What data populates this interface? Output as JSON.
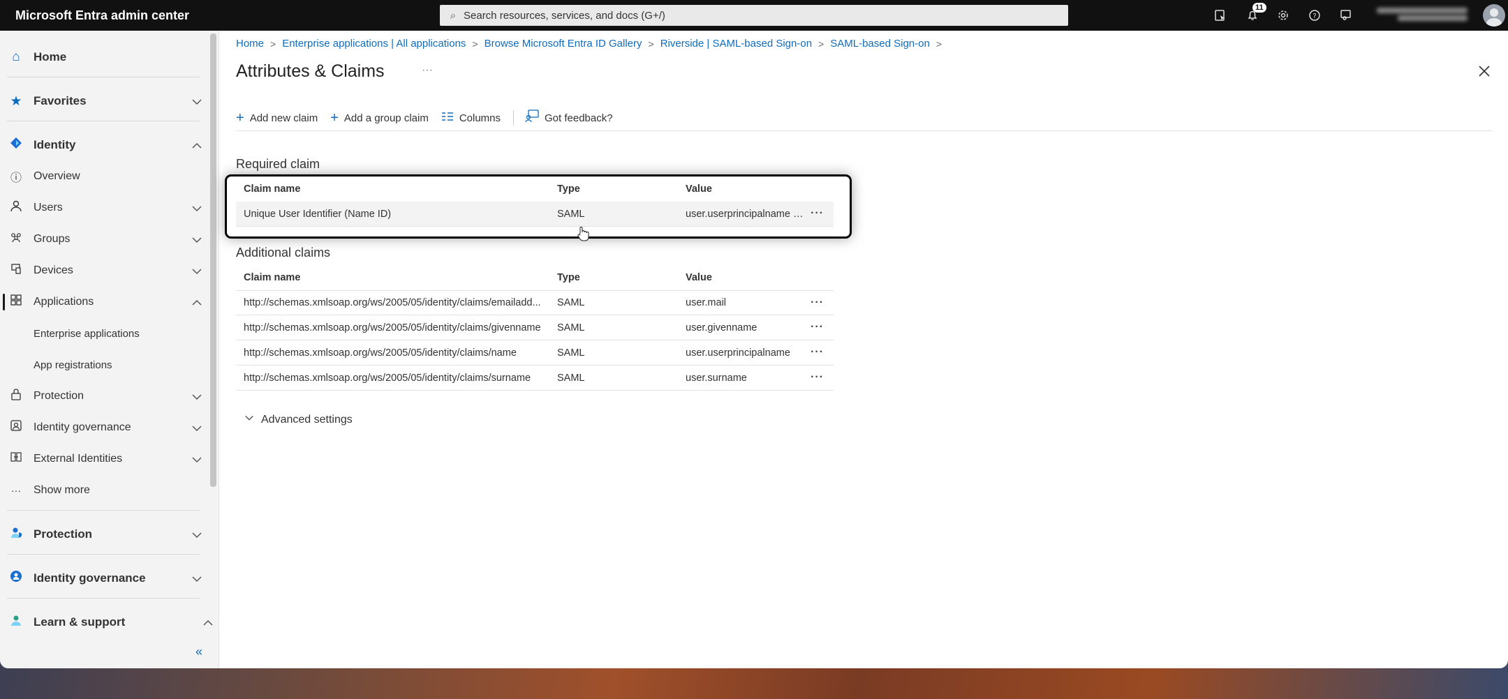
{
  "app": {
    "title": "Microsoft Entra admin center"
  },
  "search": {
    "placeholder": "Search resources, services, and docs (G+/)"
  },
  "topbar": {
    "notification_count": "11"
  },
  "sidebar": {
    "home": "Home",
    "favorites": "Favorites",
    "identity": "Identity",
    "overview": "Overview",
    "users": "Users",
    "groups": "Groups",
    "devices": "Devices",
    "applications": "Applications",
    "enterprise_applications": "Enterprise applications",
    "app_registrations": "App registrations",
    "protection_sub": "Protection",
    "identity_governance_sub": "Identity governance",
    "external_identities": "External Identities",
    "show_more": "Show more",
    "protection": "Protection",
    "identity_governance": "Identity governance",
    "learn_support": "Learn & support",
    "collapse": "«"
  },
  "breadcrumb": [
    "Home",
    "Enterprise applications | All applications",
    "Browse Microsoft Entra ID Gallery",
    "Riverside | SAML-based Sign-on",
    "SAML-based Sign-on"
  ],
  "page": {
    "title": "Attributes & Claims",
    "more": "···"
  },
  "toolbar": {
    "add_new_claim": "Add new claim",
    "add_group_claim": "Add a group claim",
    "columns": "Columns",
    "feedback": "Got feedback?"
  },
  "required": {
    "title": "Required claim",
    "headers": {
      "name": "Claim name",
      "type": "Type",
      "value": "Value"
    },
    "rows": [
      {
        "name": "Unique User Identifier (Name ID)",
        "type": "SAML",
        "value": "user.userprincipalname [..."
      }
    ]
  },
  "additional": {
    "title": "Additional claims",
    "headers": {
      "name": "Claim name",
      "type": "Type",
      "value": "Value"
    },
    "rows": [
      {
        "name": "http://schemas.xmlsoap.org/ws/2005/05/identity/claims/emailadd...",
        "type": "SAML",
        "value": "user.mail"
      },
      {
        "name": "http://schemas.xmlsoap.org/ws/2005/05/identity/claims/givenname",
        "type": "SAML",
        "value": "user.givenname"
      },
      {
        "name": "http://schemas.xmlsoap.org/ws/2005/05/identity/claims/name",
        "type": "SAML",
        "value": "user.userprincipalname"
      },
      {
        "name": "http://schemas.xmlsoap.org/ws/2005/05/identity/claims/surname",
        "type": "SAML",
        "value": "user.surname"
      }
    ]
  },
  "advanced": {
    "label": "Advanced settings"
  },
  "row_menu": "···"
}
